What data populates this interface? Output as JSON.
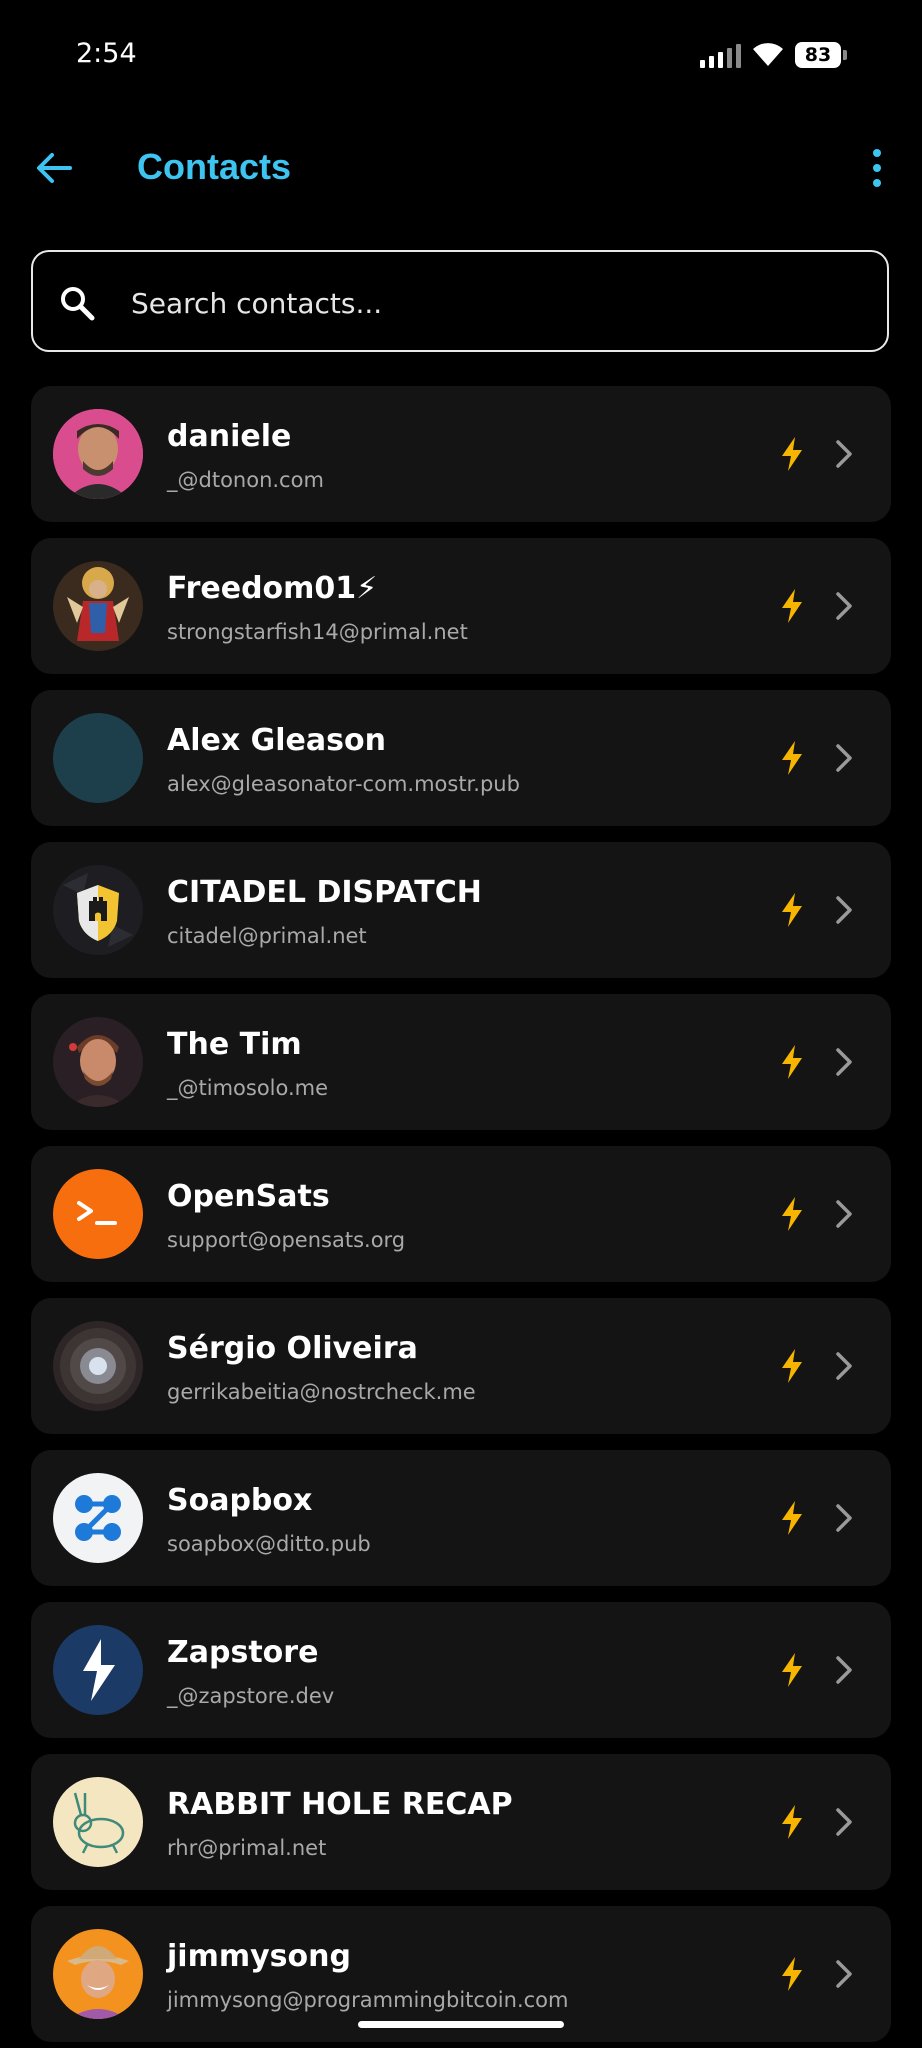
{
  "status_bar": {
    "time": "2:54",
    "battery": "83"
  },
  "app_bar": {
    "title": "Contacts",
    "back_icon": "arrow-left-icon",
    "menu_icon": "more-vertical-icon"
  },
  "search": {
    "placeholder": "Search contacts...",
    "value": ""
  },
  "colors": {
    "accent": "#3ec4f1",
    "zap": "#f7b500",
    "card": "#141414",
    "secondary_text": "#a9a9a9"
  },
  "contacts": [
    {
      "name": "daniele",
      "address": "_@dtonon.com"
    },
    {
      "name": "Freedom01⚡",
      "address": "strongstarfish14@primal.net"
    },
    {
      "name": "Alex Gleason",
      "address": "alex@gleasonator-com.mostr.pub"
    },
    {
      "name": "CITADEL DISPATCH",
      "address": "citadel@primal.net"
    },
    {
      "name": "The Tim",
      "address": "_@timosolo.me"
    },
    {
      "name": "OpenSats",
      "address": "support@opensats.org"
    },
    {
      "name": "Sérgio Oliveira",
      "address": "gerrikabeitia@nostrcheck.me"
    },
    {
      "name": "Soapbox",
      "address": "soapbox@ditto.pub"
    },
    {
      "name": "Zapstore",
      "address": "_@zapstore.dev"
    },
    {
      "name": "RABBIT HOLE RECAP",
      "address": "rhr@primal.net"
    },
    {
      "name": "jimmysong",
      "address": "jimmysong@programmingbitcoin.com"
    }
  ]
}
